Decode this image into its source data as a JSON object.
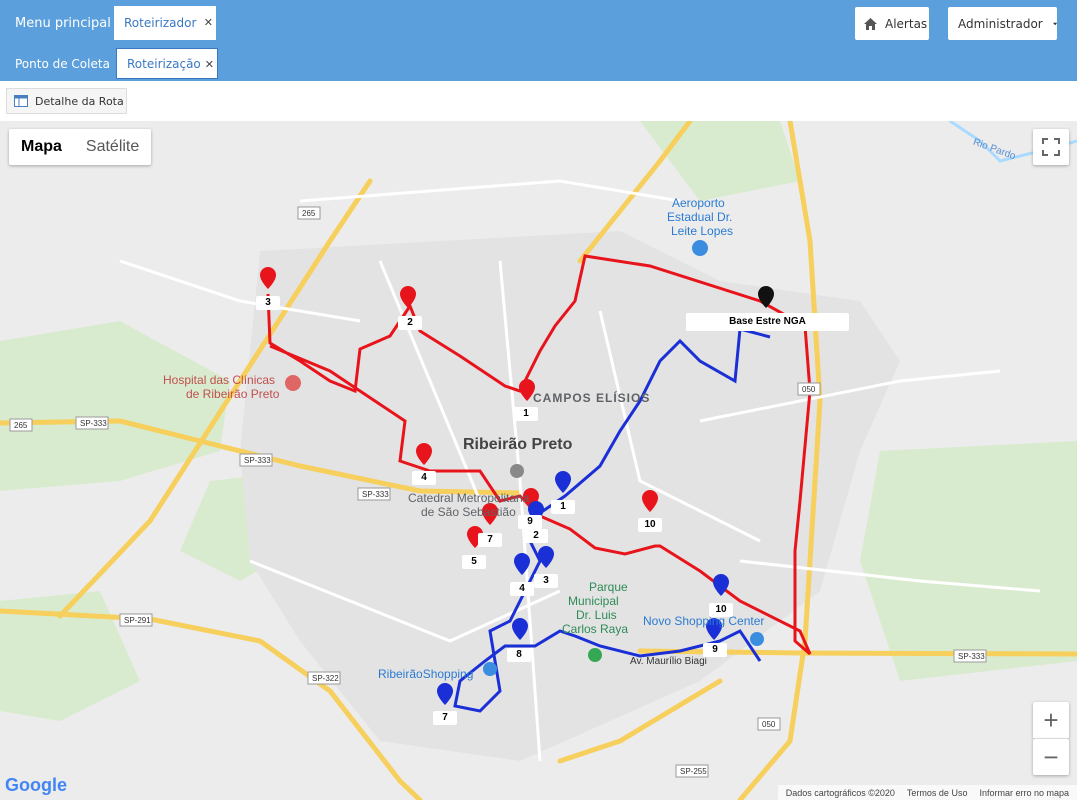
{
  "topbar": {
    "menu_principal": "Menu principal",
    "tab1": "Roteirizador",
    "ponto_coleta": "Ponto de Coleta",
    "tab2": "Roteirização",
    "alertas": "Alertas",
    "administrador": "Administrador"
  },
  "toolbar": {
    "detalhe_rota": "Detalhe da Rota"
  },
  "map": {
    "type_map": "Mapa",
    "type_satellite": "Satélite",
    "zoom_in": "+",
    "zoom_out": "−",
    "labels": {
      "city": "Ribeirão Preto",
      "campos": "CAMPOS ELÍSIOS",
      "airport1": "Aeroporto",
      "airport2": "Estadual Dr.",
      "airport3": "Leite Lopes",
      "hospital1": "Hospital das Clínicas",
      "hospital2": "de Ribeirão Preto",
      "catedral1": "Catedral Metropolitana",
      "catedral2": "de São Sebastião",
      "parque1": "Parque",
      "parque2": "Municipal",
      "parque3": "Dr. Luis",
      "parque4": "Carlos Raya",
      "shopping": "Novo Shopping Center",
      "ribeiraoshopping": "RibeirãoShopping",
      "maurilio": "Av. Maurílio Biagi",
      "rio_pardo": "Rio Pardo",
      "base": "Base Estre NGA",
      "sp333a": "SP-333",
      "sp333b": "SP-333",
      "sp333c": "SP-333",
      "sp333d": "SP-333",
      "sp291": "SP-291",
      "sp322": "SP-322",
      "sp255": "SP-255",
      "r265a": "265",
      "r265b": "265",
      "r050a": "050",
      "r050b": "050"
    },
    "red_markers": [
      "1",
      "2",
      "3",
      "4",
      "5",
      "7",
      "9",
      "10"
    ],
    "blue_markers": [
      "1",
      "2",
      "3",
      "4",
      "7",
      "8",
      "9",
      "10"
    ],
    "footer": {
      "dados": "Dados cartográficos ©2020",
      "termos": "Termos de Uso",
      "erro": "Informar erro no mapa"
    },
    "google": "Google",
    "colors": {
      "red_route": "#e8141c",
      "blue_route": "#1a2fd6",
      "header": "#5b9fdc"
    }
  }
}
